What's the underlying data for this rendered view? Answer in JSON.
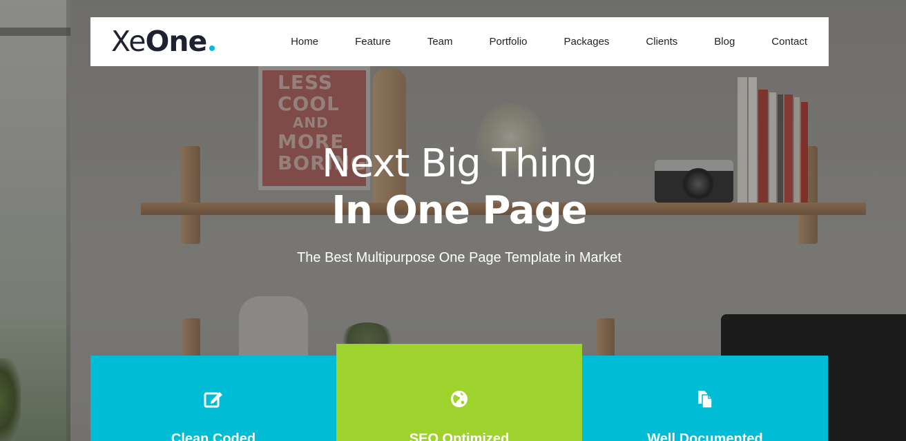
{
  "brand": {
    "logo_light": "Xe",
    "logo_bold": "One",
    "accent_color": "#00bcd4"
  },
  "nav": {
    "items": [
      "Home",
      "Feature",
      "Team",
      "Portfolio",
      "Packages",
      "Clients",
      "Blog",
      "Contact"
    ]
  },
  "hero": {
    "title_line1": "Next Big Thing",
    "title_line2": "In One Page",
    "subtitle": "The Best Multipurpose One Page Template in Market",
    "poster_text": [
      "LESS",
      "COOL",
      "AND",
      "MORE",
      "BORING"
    ]
  },
  "features": [
    {
      "title": "Clean Coded",
      "icon": "edit-icon",
      "color": "#00bcd4"
    },
    {
      "title": "SEO Optimized",
      "icon": "globe-icon",
      "color": "#9ed22c"
    },
    {
      "title": "Well Documented",
      "icon": "documents-icon",
      "color": "#00bcd4"
    }
  ]
}
